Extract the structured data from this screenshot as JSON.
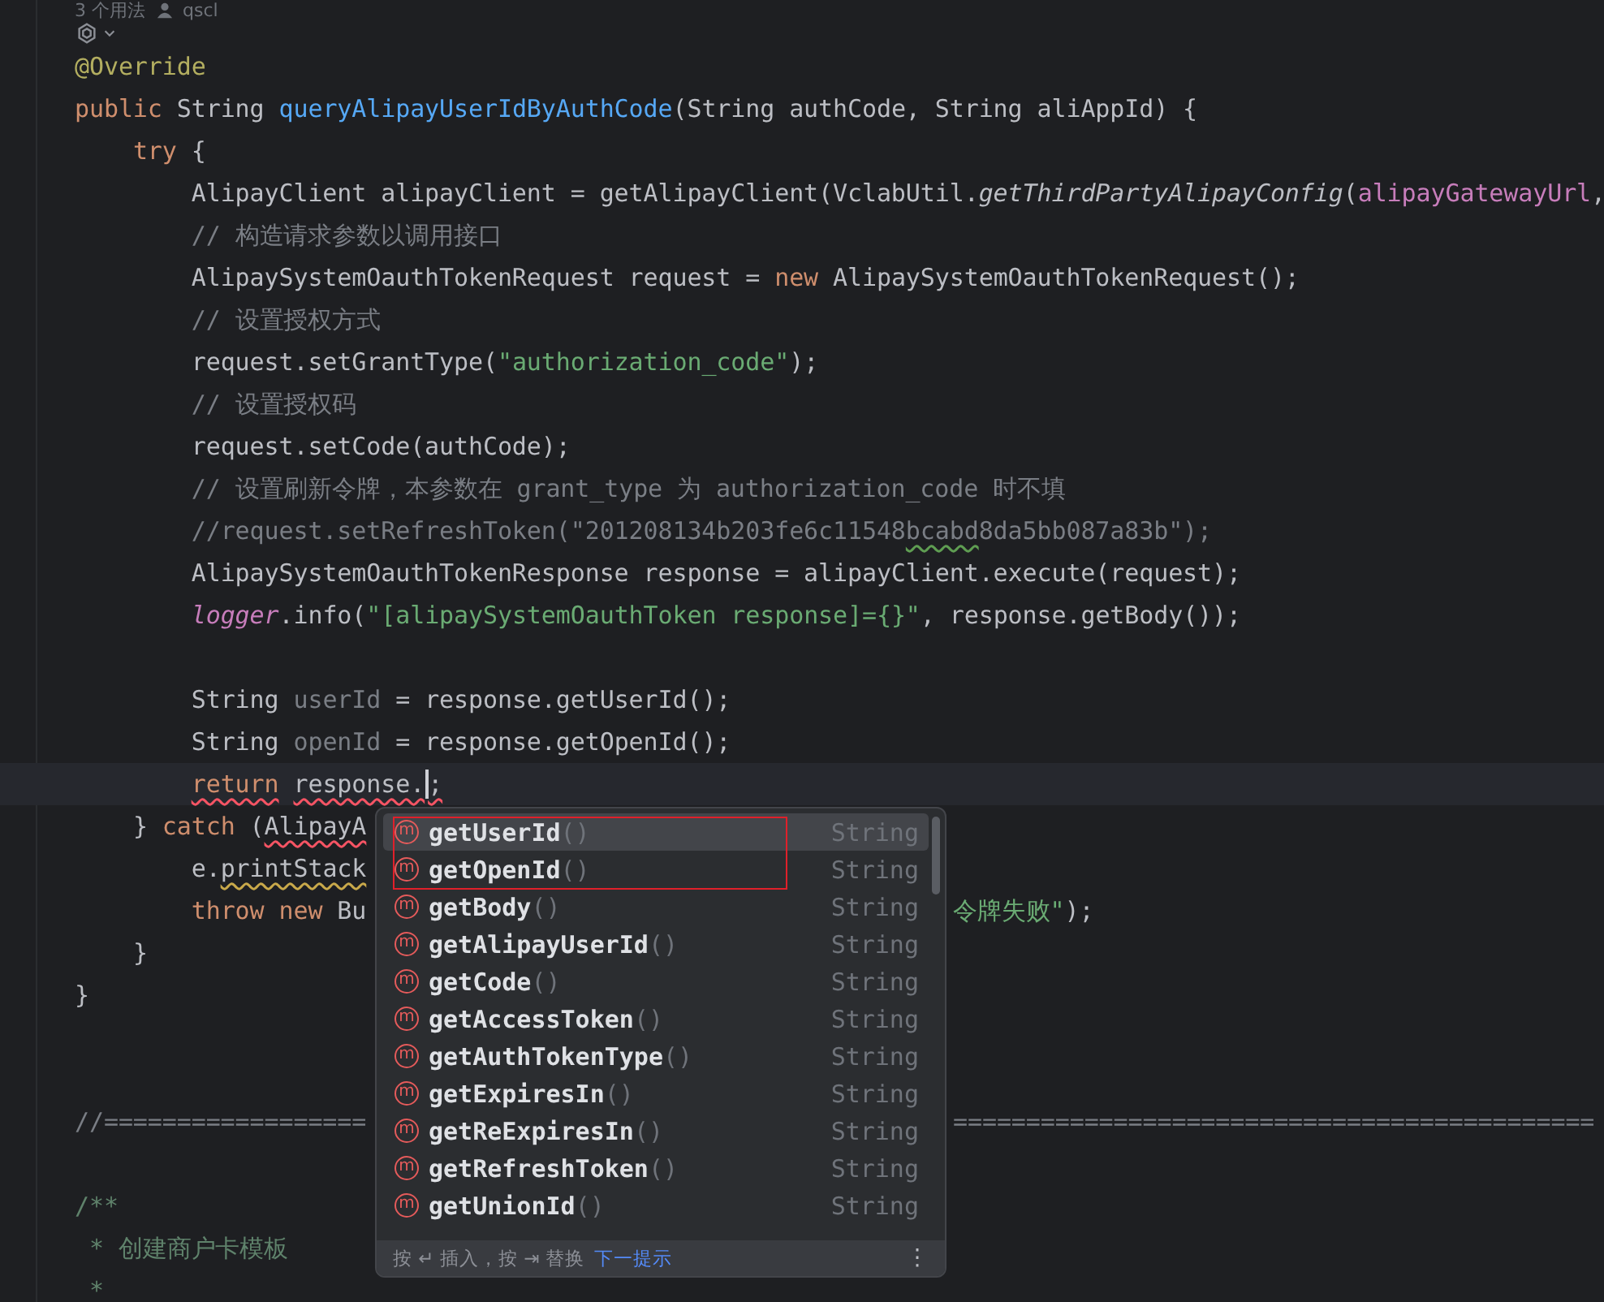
{
  "hints": {
    "usages": "3 个用法",
    "author": "qscl"
  },
  "lines": [
    {
      "tokens": [
        {
          "kind": "a",
          "t": "@Override"
        }
      ]
    },
    {
      "tokens": [
        {
          "kind": "k",
          "t": "public "
        },
        {
          "kind": "p",
          "t": "String "
        },
        {
          "kind": "f",
          "t": "queryAlipayUserIdByAuthCode"
        },
        {
          "kind": "p",
          "t": "(String authCode, String aliAppId) {"
        }
      ]
    },
    {
      "tokens": [
        {
          "kind": "k",
          "t": "    try "
        },
        {
          "kind": "p",
          "t": "{"
        }
      ]
    },
    {
      "tokens": [
        {
          "kind": "p",
          "t": "        AlipayClient alipayClient = getAlipayClient(VclabUtil."
        },
        {
          "kind": "i",
          "t": "getThirdPartyAlipayConfig"
        },
        {
          "kind": "p",
          "t": "("
        },
        {
          "kind": "v",
          "t": "alipayGatewayUrl"
        },
        {
          "kind": "p",
          "t": ","
        }
      ]
    },
    {
      "tokens": [
        {
          "kind": "c",
          "t": "        // 构造请求参数以调用接口"
        }
      ]
    },
    {
      "tokens": [
        {
          "kind": "p",
          "t": "        AlipaySystemOauthTokenRequest request = "
        },
        {
          "kind": "k",
          "t": "new "
        },
        {
          "kind": "p",
          "t": "AlipaySystemOauthTokenRequest();"
        }
      ]
    },
    {
      "tokens": [
        {
          "kind": "c",
          "t": "        // 设置授权方式"
        }
      ]
    },
    {
      "tokens": [
        {
          "kind": "p",
          "t": "        request.setGrantType("
        },
        {
          "kind": "s",
          "t": "\"authorization_code\""
        },
        {
          "kind": "p",
          "t": ");"
        }
      ]
    },
    {
      "tokens": [
        {
          "kind": "c",
          "t": "        // 设置授权码"
        }
      ]
    },
    {
      "tokens": [
        {
          "kind": "p",
          "t": "        request.setCode(authCode);"
        }
      ]
    },
    {
      "tokens": [
        {
          "kind": "c",
          "t": "        // 设置刷新令牌，本参数在 grant_type 为 authorization_code 时不填"
        }
      ]
    },
    {
      "tokens": [
        {
          "kind": "c",
          "t": "        //request.setRefreshToken(\"201208134b203fe6c11548"
        },
        {
          "kind": "c",
          "t": "bcabd",
          "typo": true
        },
        {
          "kind": "c",
          "t": "8da5bb087a83b\");"
        }
      ]
    },
    {
      "tokens": [
        {
          "kind": "p",
          "t": "        AlipaySystemOauthTokenResponse response = alipayClient.execute(request);"
        }
      ]
    },
    {
      "tokens": [
        {
          "kind": "l",
          "t": "        logger"
        },
        {
          "kind": "p",
          "t": ".info("
        },
        {
          "kind": "s",
          "t": "\"[alipaySystemOauthToken response]={}\""
        },
        {
          "kind": "p",
          "t": ", response.getBody());"
        }
      ]
    },
    {
      "blank": true
    },
    {
      "tokens": [
        {
          "kind": "p",
          "t": "        String "
        },
        {
          "kind": "u",
          "t": "userId"
        },
        {
          "kind": "p",
          "t": " = response.getUserId();"
        }
      ]
    },
    {
      "tokens": [
        {
          "kind": "p",
          "t": "        String "
        },
        {
          "kind": "u",
          "t": "openId"
        },
        {
          "kind": "p",
          "t": " = response.getOpenId();"
        }
      ]
    },
    {
      "current": true,
      "tokens": [
        {
          "kind": "k",
          "t": "        return",
          "error": true
        },
        {
          "kind": "p",
          "t": " response.",
          "error": true
        }
      ],
      "after_cursor": [
        {
          "kind": "p",
          "t": ";",
          "error": true
        }
      ]
    },
    {
      "tokens": [
        {
          "kind": "p",
          "t": "    } "
        },
        {
          "kind": "k",
          "t": "catch "
        },
        {
          "kind": "p",
          "t": "("
        },
        {
          "kind": "p",
          "t": "AlipayA",
          "error": true
        }
      ]
    },
    {
      "tokens": [
        {
          "kind": "p",
          "t": "        e."
        },
        {
          "kind": "p",
          "t": "printStack",
          "warning": true
        }
      ]
    },
    {
      "tokens": [
        {
          "kind": "k",
          "t": "        throw new "
        },
        {
          "kind": "p",
          "t": "Bu"
        }
      ],
      "tail": [
        {
          "kind": "s",
          "t": "令牌失败\""
        },
        {
          "kind": "p",
          "t": ");"
        }
      ]
    },
    {
      "tokens": [
        {
          "kind": "p",
          "t": "    }"
        }
      ]
    },
    {
      "tokens": [
        {
          "kind": "p",
          "t": "}"
        }
      ]
    },
    {
      "blank": true
    },
    {
      "blank": true
    },
    {
      "tokens": [
        {
          "kind": "c",
          "t": "//=================="
        }
      ],
      "tail": [
        {
          "kind": "c",
          "t": "============================================"
        }
      ]
    },
    {
      "blank": true
    },
    {
      "tokens": [
        {
          "kind": "d",
          "t": "/**"
        }
      ]
    },
    {
      "tokens": [
        {
          "kind": "d",
          "t": " * 创建商户卡模板"
        }
      ]
    },
    {
      "tokens": [
        {
          "kind": "d",
          "t": " *"
        }
      ]
    }
  ],
  "popup": {
    "items": [
      {
        "icon": "m",
        "name": "getUserId",
        "parens": "()",
        "type": "String",
        "selected": true,
        "boxed": true
      },
      {
        "icon": "m",
        "name": "getOpenId",
        "parens": "()",
        "type": "String",
        "selected": false,
        "boxed": true
      },
      {
        "icon": "m",
        "name": "getBody",
        "parens": "()",
        "type": "String",
        "selected": false,
        "boxed": false
      },
      {
        "icon": "m",
        "name": "getAlipayUserId",
        "parens": "()",
        "type": "String",
        "selected": false,
        "boxed": false
      },
      {
        "icon": "m",
        "name": "getCode",
        "parens": "()",
        "type": "String",
        "selected": false,
        "boxed": false
      },
      {
        "icon": "m",
        "name": "getAccessToken",
        "parens": "()",
        "type": "String",
        "selected": false,
        "boxed": false
      },
      {
        "icon": "m",
        "name": "getAuthTokenType",
        "parens": "()",
        "type": "String",
        "selected": false,
        "boxed": false
      },
      {
        "icon": "m",
        "name": "getExpiresIn",
        "parens": "()",
        "type": "String",
        "selected": false,
        "boxed": false
      },
      {
        "icon": "m",
        "name": "getReExpiresIn",
        "parens": "()",
        "type": "String",
        "selected": false,
        "boxed": false
      },
      {
        "icon": "m",
        "name": "getRefreshToken",
        "parens": "()",
        "type": "String",
        "selected": false,
        "boxed": false
      },
      {
        "icon": "m",
        "name": "getUnionId",
        "parens": "()",
        "type": "String",
        "selected": false,
        "boxed": false
      }
    ],
    "footer": {
      "hint": "按 ↵ 插入，按 ⇥ 替换",
      "link": "下一提示",
      "menu": "⋮"
    }
  }
}
